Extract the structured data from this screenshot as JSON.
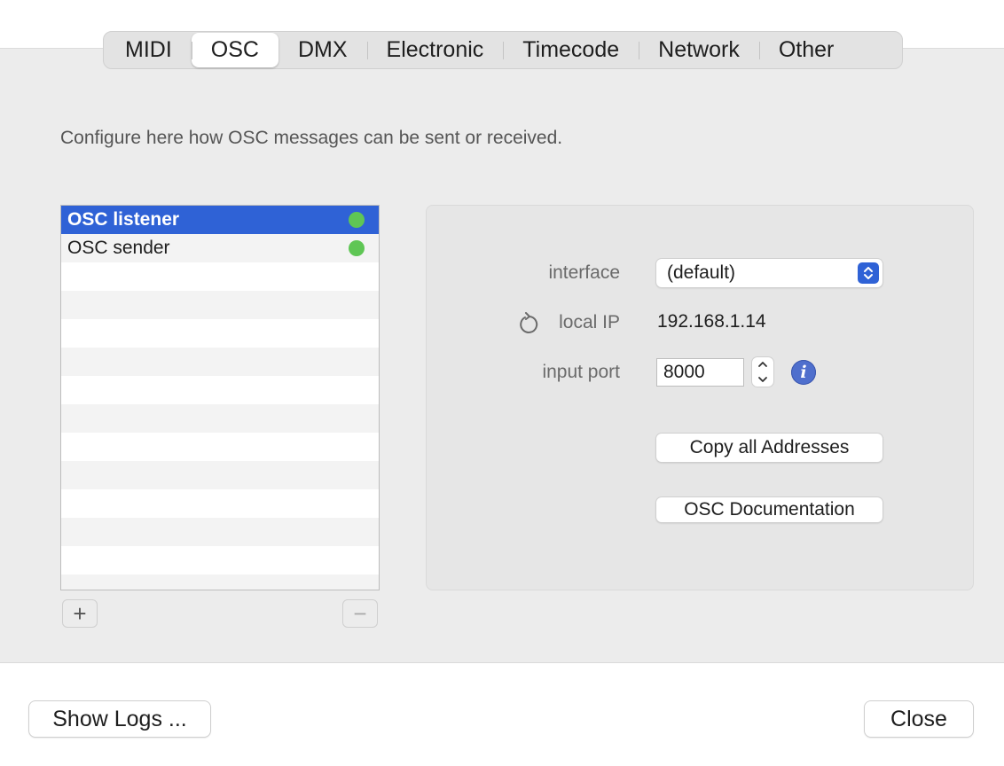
{
  "tabs": [
    "MIDI",
    "OSC",
    "DMX",
    "Electronic",
    "Timecode",
    "Network",
    "Other"
  ],
  "active_tab": "OSC",
  "description": "Configure here how OSC messages can be sent or received.",
  "list": {
    "items": [
      {
        "label": "OSC listener",
        "status_color": "#5fc655",
        "selected": true
      },
      {
        "label": "OSC sender",
        "status_color": "#5fc655",
        "selected": false
      }
    ],
    "add_symbol": "+",
    "remove_symbol": "−"
  },
  "settings": {
    "interface_label": "interface",
    "interface_value": "(default)",
    "local_ip_label": "local IP",
    "local_ip_value": "192.168.1.14",
    "input_port_label": "input port",
    "input_port_value": "8000",
    "copy_button": "Copy all Addresses",
    "docs_button": "OSC Documentation",
    "info_symbol": "i"
  },
  "footer": {
    "show_logs": "Show Logs ...",
    "close": "Close"
  },
  "colors": {
    "accent": "#2f62d6",
    "status_green": "#5fc655",
    "info_blue": "#4f6fcd"
  },
  "icons": {
    "refresh": "refresh-icon",
    "info": "info-icon",
    "select_arrows": "chevron-updown-icon"
  }
}
